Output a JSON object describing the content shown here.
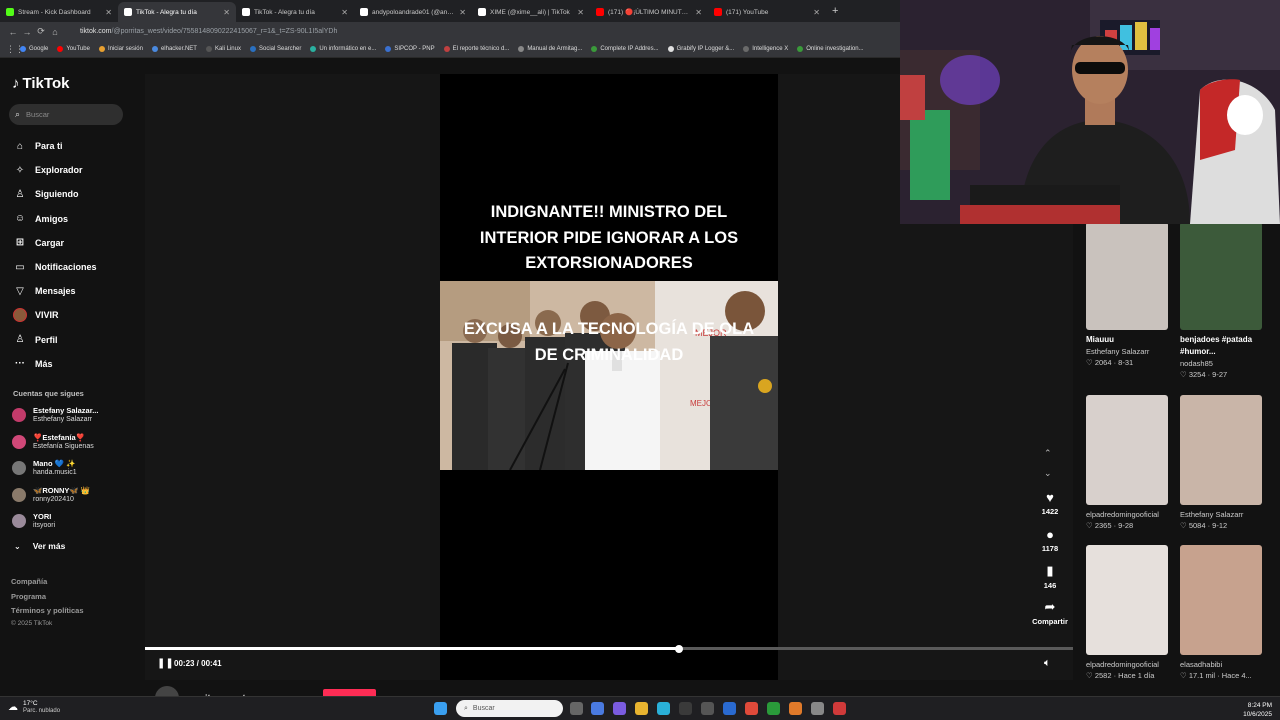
{
  "browser": {
    "tabs": [
      {
        "title": "Stream - Kick Dashboard",
        "color": "#53fc18"
      },
      {
        "title": "TikTok - Alegra tu día",
        "color": "#ffffff",
        "active": true
      },
      {
        "title": "TikTok - Alegra tu día",
        "color": "#ffffff"
      },
      {
        "title": "andypoloandrade01 (@andypo",
        "color": "#ffffff"
      },
      {
        "title": "XIME (@xime__ali) | TikTok",
        "color": "#ffffff"
      },
      {
        "title": "(171) 🔴¡ÚLTIMO MINUTO! PR",
        "color": "#ff0000"
      },
      {
        "title": "(171) YouTube",
        "color": "#ff0000"
      }
    ],
    "url_host": "tiktok.com",
    "url_path": "/@porritas_west/video/7558148090222415067_r=1&_t=ZS-90L1I5alYDh",
    "bookmarks": [
      "Google",
      "YouTube",
      "Iniciar sesión",
      "elhacker.NET",
      "Kali Linux",
      "Social Searcher",
      "Un informático en e...",
      "SIPCOP - PNP",
      "El reporte técnico d...",
      "Manual de Armitag...",
      "Complete IP Addres...",
      "Grabify IP Logger &...",
      "Intelligence X",
      "Online investigation..."
    ]
  },
  "sidebar": {
    "logo": "TikTok",
    "search_placeholder": "Buscar",
    "nav": [
      {
        "label": "Para ti",
        "icon": "⌂"
      },
      {
        "label": "Explorador",
        "icon": "✧"
      },
      {
        "label": "Siguiendo",
        "icon": "♙"
      },
      {
        "label": "Amigos",
        "icon": "☺"
      },
      {
        "label": "Cargar",
        "icon": "⊞"
      },
      {
        "label": "Notificaciones",
        "icon": "▭"
      },
      {
        "label": "Mensajes",
        "icon": "▽"
      },
      {
        "label": "VIVIR",
        "icon": "avatar"
      },
      {
        "label": "Perfil",
        "icon": "♙"
      },
      {
        "label": "Más",
        "icon": "···"
      }
    ],
    "following_title": "Cuentas que sigues",
    "accounts": [
      {
        "name": "Estefany Salazar...",
        "handle": "Esthefany Salazarr",
        "color": "#c23b6a"
      },
      {
        "name": "❣️Estefanía❣️",
        "handle": "Estefanía Siguenas",
        "color": "#d04878"
      },
      {
        "name": "Mano 💙 ✨",
        "handle": "handa.music1",
        "color": "#777777"
      },
      {
        "name": "🦋RONNY🦋 👑",
        "handle": "ronny202410",
        "color": "#8a7a6a"
      },
      {
        "name": "YORI",
        "handle": "itsyoori",
        "color": "#9a8a9a"
      }
    ],
    "see_more": "Ver más",
    "footer": [
      "Compañía",
      "Programa",
      "Términos y políticas"
    ],
    "copyright": "© 2025 TikTok"
  },
  "video": {
    "caption_top": [
      "INDIGNANTE!! MINISTRO DEL",
      "INTERIOR PIDE IGNORAR A LOS",
      "EXTORSIONADORES"
    ],
    "caption_bottom": [
      "EXCUSA A LA TECNOLOGÍA DE OLA",
      "DE CRIMINALIDAD"
    ],
    "time": "00:23 / 00:41",
    "progress": 0.575,
    "likes": "1422",
    "comments": "1178",
    "saves": "146",
    "share": "Compartir",
    "author": "porritas_west"
  },
  "related": [
    {
      "title": "Miauuu",
      "author": "Esthefany Salazarr",
      "likes": "2064",
      "date": "8-31",
      "bg": "#c9c2bd"
    },
    {
      "title": "benjadoes #patada",
      "title2": "#humor...",
      "author": "nodash85",
      "likes": "3254",
      "date": "9-27",
      "bg": "#3c5a3a"
    },
    {
      "title": "",
      "author": "elpadredomingooficial",
      "likes": "2365",
      "date": "9-28",
      "bg": "#d8d0cc"
    },
    {
      "title": "",
      "author": "Esthefany Salazarr",
      "likes": "5084",
      "date": "9-12",
      "bg": "#c9b5a8"
    },
    {
      "title": "",
      "author": "elpadredomingooficial",
      "likes": "2582",
      "date": "Hace 1 día",
      "bg": "#e6e0dc"
    },
    {
      "title": "",
      "author": "elasadhabibi",
      "likes": "17.1 mil",
      "date": "Hace 4...",
      "bg": "#c7a28e"
    }
  ],
  "taskbar": {
    "temp": "17°C",
    "weather": "Parc. nublado",
    "search_placeholder": "Buscar",
    "time": "8:24 PM",
    "date": "10/6/2025"
  }
}
